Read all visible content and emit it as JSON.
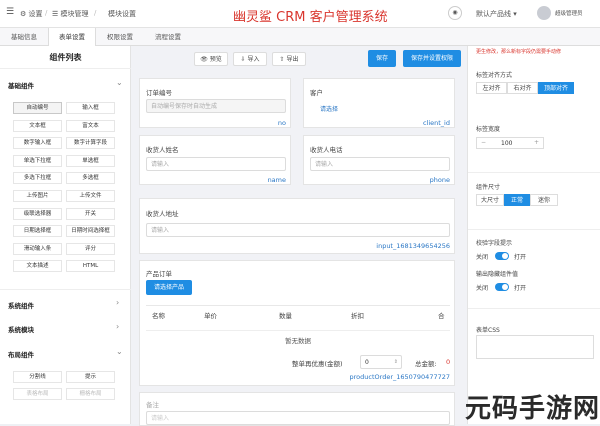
{
  "topbar": {
    "settings": "设置",
    "module_mgmt": "模块管理",
    "module_settings": "模块设置",
    "title": "幽灵鲨 CRM 客户管理系统",
    "default_product": "默认产品线",
    "admin": "超级管理员"
  },
  "tabs": [
    "基础信息",
    "表单设置",
    "权限设置",
    "流程设置"
  ],
  "left": {
    "title": "组件列表",
    "basic_header": "基础组件",
    "components": [
      "自动编号",
      "输入框",
      "文本框",
      "富文本",
      "数字输入框",
      "数字计算字段",
      "单选下拉框",
      "单选框",
      "多选下拉框",
      "多选框",
      "上传图片",
      "上传文件",
      "级联选择器",
      "开关",
      "日期选择框",
      "日期时间选择框",
      "滑动输入条",
      "评分",
      "文本描述",
      "HTML"
    ],
    "system_header": "系统组件",
    "system_module_header": "系统模块",
    "layout_header": "布局组件",
    "layout_components": [
      "分割线",
      "提示",
      "表格布局",
      "栅格布局"
    ]
  },
  "toolbar": {
    "preview": "预览",
    "import": "导入",
    "export": "导出",
    "save": "保存",
    "save_perm": "保存并设置权限"
  },
  "form": {
    "order_no": {
      "label": "订单编号",
      "placeholder": "自动编号保存时自动生成",
      "field": "no"
    },
    "customer": {
      "label": "客户",
      "value": "请选择",
      "field": "client_id"
    },
    "receiver_name": {
      "label": "收货人姓名",
      "placeholder": "请输入",
      "field": "name"
    },
    "receiver_phone": {
      "label": "收货人电话",
      "placeholder": "请输入",
      "field": "phone"
    },
    "address": {
      "label": "收货人地址",
      "placeholder": "请输入",
      "field": "input_1681349654256"
    },
    "products": {
      "label": "产品订单",
      "select_btn": "请选择产品",
      "columns": [
        "名称",
        "单价",
        "数量",
        "折扣",
        "合"
      ],
      "empty": "暂无数据",
      "discount_label": "整单再优惠(金额)",
      "discount_value": "0",
      "total_label": "总金额:",
      "total_value": "0",
      "field": "productOrder_1650790477727"
    },
    "remark": {
      "label": "备注",
      "placeholder": "请输入"
    }
  },
  "right": {
    "warning": "更生修改，那么新标字段仍需要手动修",
    "label_align": "标签对齐方式",
    "align_opts": [
      "左对齐",
      "右对齐",
      "顶部对齐"
    ],
    "label_width": "标签宽度",
    "width_minus": "−",
    "label_width_value": "100",
    "width_plus": "+",
    "comp_size": "组件尺寸",
    "size_opts": [
      "大尺寸",
      "正常",
      "迷你"
    ],
    "check_field": "校验字段提示",
    "check_off": "关闭",
    "check_on": "打开",
    "hidden_field": "输出隐藏组件值",
    "hidden_off": "关闭",
    "hidden_on": "打开",
    "form_css": "表单CSS"
  },
  "watermark": "元码手游网"
}
